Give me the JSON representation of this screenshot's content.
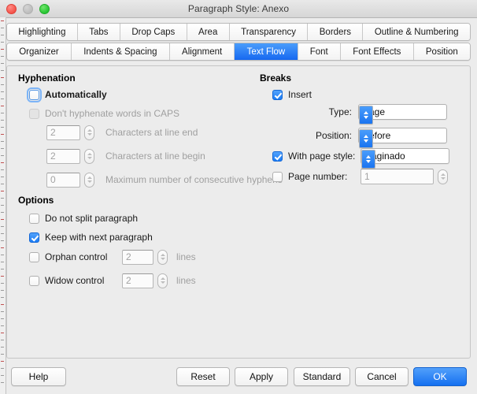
{
  "window": {
    "title": "Paragraph Style: Anexo",
    "traffic_lights": [
      "close-button",
      "minimize-button",
      "zoom-button"
    ]
  },
  "tabs": {
    "row1": [
      {
        "label": "Highlighting",
        "selected": false
      },
      {
        "label": "Tabs",
        "selected": false
      },
      {
        "label": "Drop Caps",
        "selected": false
      },
      {
        "label": "Area",
        "selected": false
      },
      {
        "label": "Transparency",
        "selected": false
      },
      {
        "label": "Borders",
        "selected": false
      },
      {
        "label": "Outline & Numbering",
        "selected": false
      }
    ],
    "row2": [
      {
        "label": "Organizer",
        "selected": false
      },
      {
        "label": "Indents & Spacing",
        "selected": false
      },
      {
        "label": "Alignment",
        "selected": false
      },
      {
        "label": "Text Flow",
        "selected": true
      },
      {
        "label": "Font",
        "selected": false
      },
      {
        "label": "Font Effects",
        "selected": false
      },
      {
        "label": "Position",
        "selected": false
      }
    ]
  },
  "hyphenation": {
    "title": "Hyphenation",
    "automatically": {
      "label": "Automatically",
      "checked": false,
      "focused": true
    },
    "no_caps": {
      "label": "Don't hyphenate words in CAPS",
      "checked": false,
      "disabled": true
    },
    "chars_line_end": {
      "label": "Characters at line end",
      "value": "2",
      "disabled": true
    },
    "chars_line_begin": {
      "label": "Characters at line begin",
      "value": "2",
      "disabled": true
    },
    "max_hyphens": {
      "label": "Maximum number of consecutive hyphens",
      "value": "0",
      "disabled": true
    }
  },
  "breaks": {
    "title": "Breaks",
    "insert": {
      "label": "Insert",
      "checked": true
    },
    "type": {
      "label": "Type:",
      "value": "Page"
    },
    "position": {
      "label": "Position:",
      "value": "Before"
    },
    "with_page_style": {
      "label": "With page style:",
      "checked": true,
      "value": "Paginado"
    },
    "page_number": {
      "label": "Page number:",
      "checked": false,
      "value": "1",
      "disabled": true
    }
  },
  "options": {
    "title": "Options",
    "do_not_split": {
      "label": "Do not split paragraph",
      "checked": false
    },
    "keep_with_next": {
      "label": "Keep with next paragraph",
      "checked": true
    },
    "orphan_control": {
      "label": "Orphan control",
      "checked": false,
      "value": "2",
      "unit": "lines",
      "disabled": true
    },
    "widow_control": {
      "label": "Widow control",
      "checked": false,
      "value": "2",
      "unit": "lines",
      "disabled": true
    }
  },
  "buttons": {
    "help": "Help",
    "reset": "Reset",
    "apply": "Apply",
    "standard": "Standard",
    "cancel": "Cancel",
    "ok": "OK"
  },
  "colors": {
    "accent": "#1b7cf5",
    "selected_tab": "#1668f0",
    "window_bg": "#ececec",
    "disabled_text": "#a0a0a0"
  }
}
